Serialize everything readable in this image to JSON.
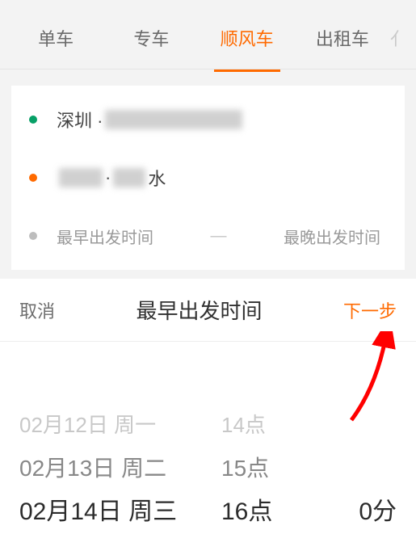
{
  "tabs": {
    "t1": "单车",
    "t2": "专车",
    "t3": "顺风车",
    "t4": "出租车",
    "extra": "亻"
  },
  "origin": {
    "prefix": "深圳 ·"
  },
  "destination": {
    "suffix": "水"
  },
  "time": {
    "earliest": "最早出发时间",
    "sep": "—",
    "latest": "最晚出发时间"
  },
  "sheet": {
    "cancel": "取消",
    "title": "最早出发时间",
    "next": "下一步"
  },
  "picker": {
    "date": {
      "far": "02月12日 周一",
      "near": "02月13日 周二",
      "sel": "02月14日 周三"
    },
    "hour": {
      "far": "14点",
      "near": "15点",
      "sel": "16点"
    },
    "min": {
      "sel": "0分"
    }
  }
}
